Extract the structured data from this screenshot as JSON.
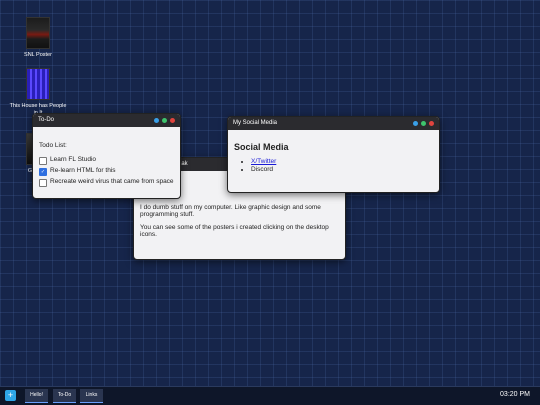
{
  "desktop": {
    "icons": [
      {
        "label": "SNL Poster"
      },
      {
        "label": "This House has People in It"
      },
      {
        "label": "Gen Ent"
      }
    ]
  },
  "windows": {
    "about": {
      "title": "reak",
      "paragraph1": "I do dumb stuff on my computer. Like graphic design and some programming stuff.",
      "paragraph2": "You can see some of the posters i created clicking on the desktop icons."
    },
    "todo": {
      "title": "To-Do",
      "heading": "Todo List:",
      "items": [
        {
          "label": "Learn FL Studio",
          "checked": false
        },
        {
          "label": "Re-learn HTML for this",
          "checked": true
        },
        {
          "label": "Recreate weird virus that came from space",
          "checked": false
        }
      ]
    },
    "social": {
      "title": "My Social Media",
      "heading": "Social Media",
      "links": [
        {
          "label": "X/Twitter",
          "is_link": true
        },
        {
          "label": "Discord",
          "is_link": false
        }
      ]
    }
  },
  "window_controls": {
    "colors": {
      "minimize": "#3aa0e8",
      "maximize": "#3ec46d",
      "close": "#e0443e"
    }
  },
  "taskbar": {
    "start_icon": "+",
    "tabs": [
      {
        "label": "Hello!"
      },
      {
        "label": "To-Do"
      },
      {
        "label": "Links"
      }
    ],
    "clock": "03:20 PM"
  }
}
